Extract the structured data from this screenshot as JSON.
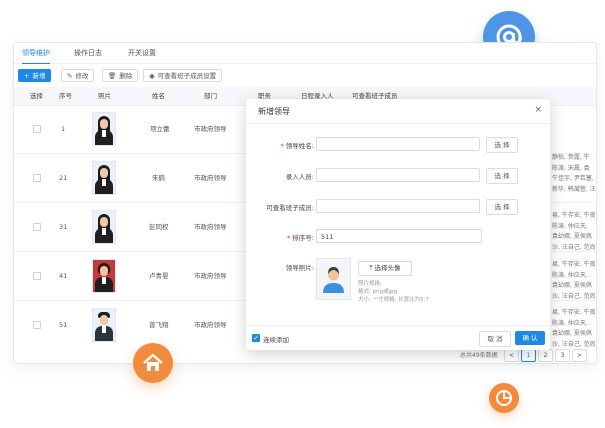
{
  "tabs": [
    "领导维护",
    "操作日志",
    "开关设置"
  ],
  "toolbar": {
    "add": "新增",
    "edit": "修改",
    "delete": "删除",
    "view": "可查看班子成员设置"
  },
  "columns": [
    "选择",
    "序号",
    "照片",
    "姓名",
    "部门",
    "职务",
    "日程录入人",
    "可查看班子成员"
  ],
  "rows": [
    {
      "seq": "1",
      "name": "项立蕾",
      "dept": "市政府领导"
    },
    {
      "seq": "21",
      "name": "朱鹤",
      "dept": "市政府领导"
    },
    {
      "seq": "31",
      "name": "彭同权",
      "dept": "市政府领导"
    },
    {
      "seq": "41",
      "name": "卢青晏",
      "dept": "市政府领导"
    },
    {
      "seq": "51",
      "name": "曾飞翔",
      "dept": "市政府领导"
    }
  ],
  "row_right_text": [
    [
      "静怡, 贺露, 牛",
      "陈涛, 宋晨, 袁",
      "牛佳宇, 尹若塞, 袁幼",
      "新华, 韩凝萱, 汪自"
    ],
    [
      "易, 牛存安, 牛夜",
      "陈涛, 仲应天,",
      "袁幼娜, 夏侯佩",
      "沙, 汪自己, 范尚白,"
    ],
    [
      "易, 牛存安, 牛夜",
      "陈涛, 仲应天,",
      "袁幼娜, 夏侯佩",
      "沙, 汪自己, 范尚白,"
    ],
    [
      "易, 牛存安, 牛夜",
      "陈涛, 仲应天,",
      "袁幼娜, 夏侯佩",
      "沙, 汪自己, 范尚白,"
    ],
    [
      "易, 牛存安, 牛夜",
      "陈涛, 仲应天,",
      "袁幼娜, 夏侯佩",
      "沙, 汪自己, 范尚白,"
    ]
  ],
  "pagination": {
    "total": "总共49条数据",
    "pages": [
      "1",
      "2",
      "3"
    ],
    "prev": "<",
    "next": ">"
  },
  "modal": {
    "title": "新增领导",
    "close": "×",
    "fields": {
      "name_label": "领导姓名:",
      "entry_label": "录入人员:",
      "view_label": "可查看班子成员:",
      "order_label": "排序号:",
      "order_value": "511",
      "photo_label": "领导照片:"
    },
    "select_label": "选 择",
    "upload_label": "选择头像",
    "hint_title": "照片规格:",
    "hint_format": "格式: png或jpg",
    "hint_size": "大小: 一寸规格, 长宽比为5:7",
    "continue_label": "连续添加",
    "cancel": "取 消",
    "confirm": "确 认"
  },
  "colors": {
    "primary": "#1e88e5",
    "at_circle": "#4f95e6",
    "home_circle": "#f28b3c",
    "chart_circle": "#f28b3c"
  },
  "icons": [
    "at-icon",
    "home-icon",
    "pie-chart-icon",
    "plus-icon",
    "edit-icon",
    "trash-icon",
    "eye-icon",
    "upload-icon",
    "user-avatar-icon"
  ]
}
